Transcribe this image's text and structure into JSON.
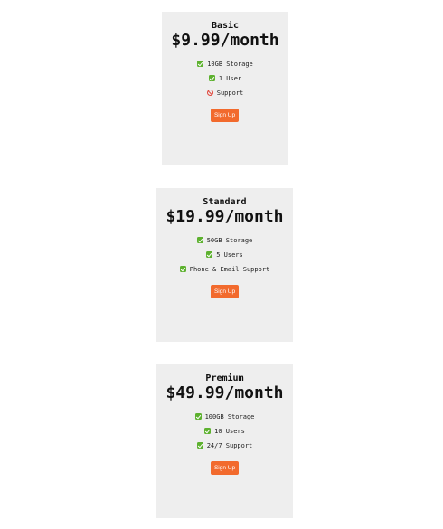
{
  "plans": [
    {
      "name": "Basic",
      "price": "$9.99/month",
      "features": [
        {
          "icon": "check-icon",
          "text": "10GB Storage"
        },
        {
          "icon": "check-icon",
          "text": "1 User"
        },
        {
          "icon": "prohibited-icon",
          "text": "Support"
        }
      ],
      "cta": "Sign Up"
    },
    {
      "name": "Standard",
      "price": "$19.99/month",
      "features": [
        {
          "icon": "check-icon",
          "text": "50GB Storage"
        },
        {
          "icon": "check-icon",
          "text": "5 Users"
        },
        {
          "icon": "check-icon",
          "text": "Phone & Email Support"
        }
      ],
      "cta": "Sign Up"
    },
    {
      "name": "Premium",
      "price": "$49.99/month",
      "features": [
        {
          "icon": "check-icon",
          "text": "100GB Storage"
        },
        {
          "icon": "check-icon",
          "text": "10 Users"
        },
        {
          "icon": "check-icon",
          "text": "24/7 Support"
        }
      ],
      "cta": "Sign Up"
    }
  ],
  "colors": {
    "card_background": "#eeeeee",
    "button": "#f26a2d",
    "check": "#5db12f",
    "prohibited": "#e0463b"
  }
}
